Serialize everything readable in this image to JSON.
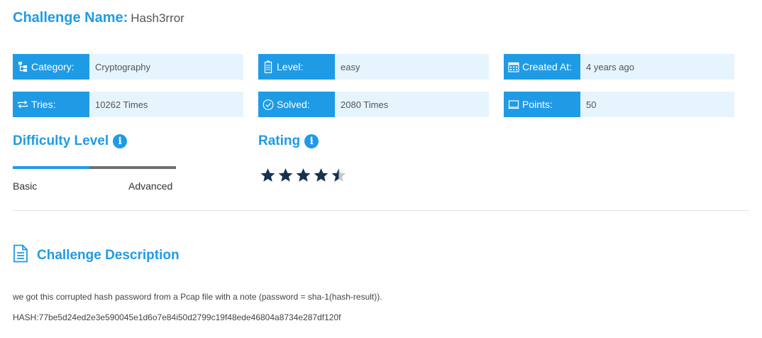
{
  "header": {
    "label": "Challenge Name:",
    "name": "Hash3rror"
  },
  "info": {
    "category": {
      "key": "Category:",
      "value": "Cryptography",
      "icon": "sitemap-icon"
    },
    "level": {
      "key": "Level:",
      "value": "easy",
      "icon": "battery-icon"
    },
    "created": {
      "key": "Created At:",
      "value": "4 years ago",
      "icon": "calendar-icon"
    },
    "tries": {
      "key": "Tries:",
      "value": "10262 Times",
      "icon": "retry-icon"
    },
    "solved": {
      "key": "Solved:",
      "value": "2080 Times",
      "icon": "check-circle-icon"
    },
    "points": {
      "key": "Points:",
      "value": "50",
      "icon": "monitor-icon"
    }
  },
  "difficulty": {
    "title": "Difficulty Level",
    "min_label": "Basic",
    "max_label": "Advanced",
    "level_fraction": 0.47
  },
  "rating": {
    "title": "Rating",
    "value": 4.5,
    "max": 5
  },
  "description": {
    "title": "Challenge Description",
    "text": "we got this corrupted hash password from a Pcap file with a note (password = sha-1(hash-result)).",
    "hash": "HASH:77be5d24ed2e3e590045e1d6o7e84i50d2799c19f48ede46804a8734e287df120f"
  },
  "colors": {
    "accent": "#1f9be6",
    "accent_light": "#e6f4fd",
    "star": "#16324f",
    "star_empty": "#c8c8c8"
  }
}
